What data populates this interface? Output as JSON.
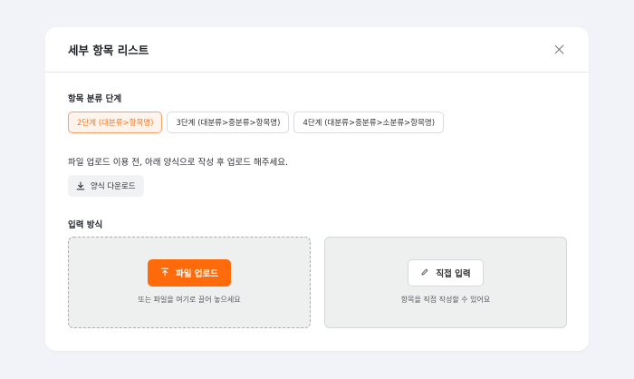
{
  "modal": {
    "title": "세부 항목 리스트",
    "close_icon": "close-icon"
  },
  "classification": {
    "label": "항목 분류 단계",
    "options": [
      {
        "label": "2단계 (대분류>항목명)",
        "selected": true
      },
      {
        "label": "3단계 (대분류>중분류>항목명)",
        "selected": false
      },
      {
        "label": "4단계 (대분류>중분류>소분류>항목명)",
        "selected": false
      }
    ]
  },
  "notice": "파일 업로드 이용 전, 아래 양식으로 작성 후 업로드 해주세요.",
  "download": {
    "label": "양식 다운로드",
    "icon": "download-icon"
  },
  "input_method": {
    "label": "입력 방식",
    "upload": {
      "button_label": "파일 업로드",
      "icon": "upload-icon",
      "hint": "또는 파일을 여기로 끌어 놓으세요"
    },
    "direct": {
      "button_label": "직접 입력",
      "icon": "pencil-icon",
      "hint": "항목을 직접 작성할 수 있어요"
    }
  },
  "colors": {
    "accent": "#ff6b0a",
    "selected_border": "#f7a06a",
    "selected_bg": "#fff4ec",
    "page_bg": "#f1f3f8"
  }
}
